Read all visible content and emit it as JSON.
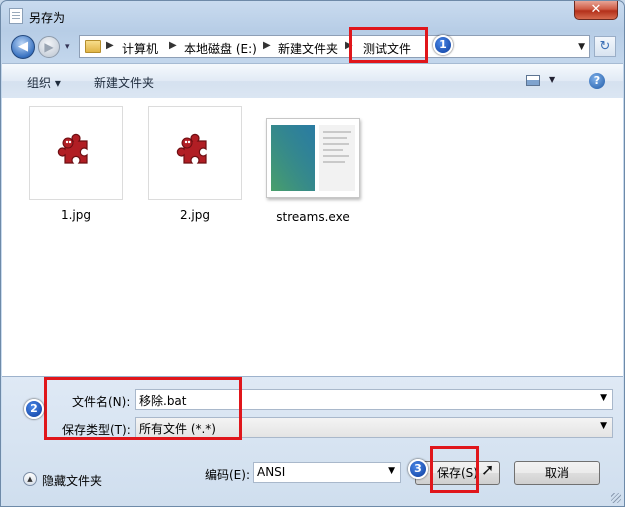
{
  "window": {
    "title": "另存为",
    "close_label": "✕"
  },
  "nav": {
    "breadcrumbs": [
      "计算机",
      "本地磁盘 (E:)",
      "新建文件夹",
      "测试文件"
    ]
  },
  "toolbar": {
    "organize": "组织 ▾",
    "new_folder": "新建文件夹",
    "help": "?"
  },
  "files": [
    {
      "name": "1.jpg",
      "icon": "puzzle-image-icon"
    },
    {
      "name": "2.jpg",
      "icon": "puzzle-image-icon"
    },
    {
      "name": "streams.exe",
      "icon": "exe-window-icon"
    }
  ],
  "form": {
    "filename_label": "文件名(N):",
    "filename_value": "移除.bat",
    "filetype_label": "保存类型(T):",
    "filetype_value": "所有文件  (*.*)",
    "encoding_label": "编码(E):",
    "encoding_value": "ANSI",
    "hide_folders": "隐藏文件夹",
    "save_button": "保存(S)",
    "cancel_button": "取消"
  },
  "annotations": {
    "badge1": "1",
    "badge2": "2",
    "badge3": "3"
  },
  "colors": {
    "highlight_red": "#e0161b",
    "badge_blue": "#1a4fb8"
  }
}
